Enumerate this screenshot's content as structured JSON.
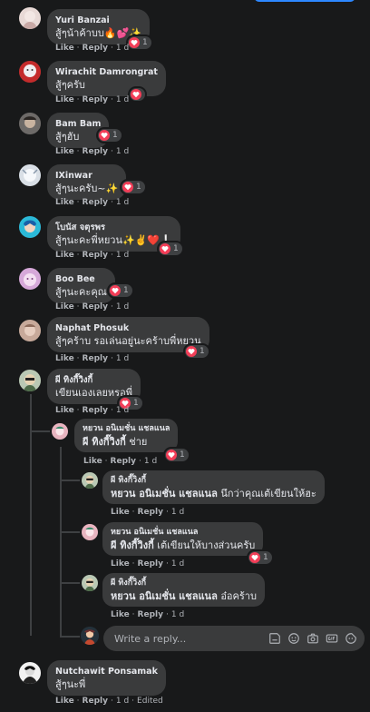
{
  "colors": {
    "background": "#18191a",
    "bubble": "#3a3b3c",
    "text": "#e4e6eb",
    "muted": "#b0b3b8",
    "heart": "#f33e58",
    "accent": "#2d88ff"
  },
  "actions": {
    "like": "Like",
    "reply": "Reply"
  },
  "comments": [
    {
      "name": "Yuri Banzai",
      "text": "สู้ๆน้าค้าบบ🔥💕✨",
      "time": "1 d",
      "reactions": "1",
      "edited": ""
    },
    {
      "name": "Wirachit Damrongrat",
      "text": "สู้ๆครับ",
      "time": "1 d",
      "reactions": "",
      "edited": ""
    },
    {
      "name": "Bam Bam",
      "text": "สู้ๆฮับ",
      "time": "1 d",
      "reactions": "1",
      "edited": ""
    },
    {
      "name": "IXinwar",
      "text": "สู้ๆนะครับ~✨",
      "time": "1 d",
      "reactions": "1",
      "edited": ""
    },
    {
      "name": "โบนัส จตุรพร",
      "text": "สู้ๆนะคะพี่หยวน✨✌️❤️❕",
      "time": "1 d",
      "reactions": "1",
      "edited": ""
    },
    {
      "name": "Boo Bee",
      "text": "สู้ๆนะคะคุณ",
      "time": "1 d",
      "reactions": "1",
      "edited": ""
    },
    {
      "name": "Naphat Phosuk",
      "text": "สู้ๆคร้าบ รอเล่นอยู่นะคร้าบพี่หยวน",
      "time": "1 d",
      "reactions": "1",
      "edited": ""
    },
    {
      "name": "ผี ทิงกี๊วิงกี้",
      "text": "เขียนเองเลยหรอพี่",
      "time": "1 d",
      "reactions": "1",
      "edited": ""
    },
    {
      "name": "Nutchawit Ponsamak",
      "text": "สู้ๆนะพี่",
      "time": "1 d",
      "reactions": "",
      "edited": "Edited"
    }
  ],
  "replies": [
    {
      "name": "หยวน อนิเมชั่น แชลแนล",
      "mention": "ผี ทิงกี๊วิงกี้",
      "text": " ช่าย",
      "time": "1 d",
      "reactions": "1"
    },
    {
      "name": "ผี ทิงกี๊วิงกี้",
      "mention": "หยวน อนิเมชั่น แชลแนล",
      "text": " นึกว่าคุณเต้เขียนให้ฮะ",
      "time": "1 d",
      "reactions": ""
    },
    {
      "name": "หยวน อนิเมชั่น แชลแนล",
      "mention": "ผี ทิงกี๊วิงกี้",
      "text": " เต้เขียนให้บางส่วนครับ",
      "time": "1 d",
      "reactions": "1"
    },
    {
      "name": "ผี ทิงกี๊วิงกี้",
      "mention": "หยวน อนิเมชั่น แชลแนล",
      "text": " อ๋อคร้าบ",
      "time": "1 d",
      "reactions": ""
    }
  ],
  "reply_box": {
    "placeholder": "Write a reply..."
  }
}
